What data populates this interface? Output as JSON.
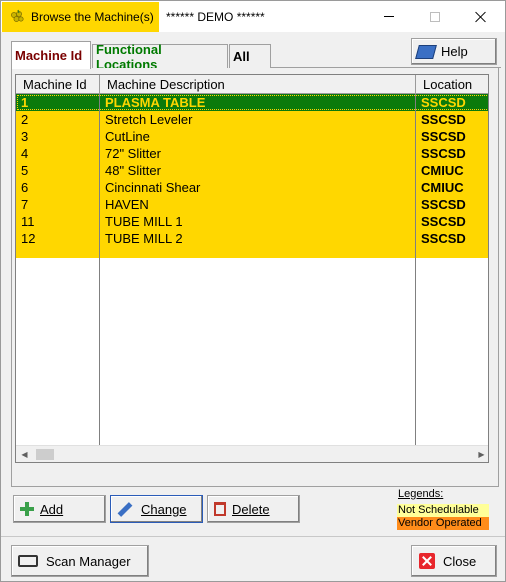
{
  "window": {
    "title": "Browse the Machine(s)",
    "subtitle": "****** DEMO ******",
    "accent_color": "#ffd700"
  },
  "tabs": [
    {
      "label": "Machine Id",
      "color": "#7a0000",
      "active": true
    },
    {
      "label": "Functional Locations",
      "color": "#007a00",
      "active": false
    },
    {
      "label": "All",
      "color": "#000000",
      "active": false
    }
  ],
  "help": {
    "label": "Help",
    "icon": "book-icon"
  },
  "grid": {
    "columns": [
      "Machine Id",
      "Machine Description",
      "Location"
    ],
    "rows": [
      {
        "id": "1",
        "description": "PLASMA TABLE",
        "location": "SSCSD",
        "selected": true
      },
      {
        "id": "2",
        "description": "Stretch Leveler",
        "location": "SSCSD"
      },
      {
        "id": "3",
        "description": "CutLine",
        "location": "SSCSD"
      },
      {
        "id": "4",
        "description": "72\" Slitter",
        "location": "SSCSD"
      },
      {
        "id": "5",
        "description": "48\" Slitter",
        "location": "CMIUC"
      },
      {
        "id": "6",
        "description": "Cincinnati Shear",
        "location": "CMIUC"
      },
      {
        "id": "7",
        "description": "HAVEN",
        "location": "SSCSD"
      },
      {
        "id": "11",
        "description": "TUBE MILL 1",
        "location": "SSCSD"
      },
      {
        "id": "12",
        "description": "TUBE MILL 2",
        "location": "SSCSD"
      }
    ],
    "row_color": "#ffd700",
    "selected_color": "#0b7a0b"
  },
  "buttons": {
    "add": "Add",
    "change": "Change",
    "delete": "Delete",
    "scan_manager": "Scan Manager",
    "close": "Close"
  },
  "legend": {
    "title": "Legends:",
    "items": [
      {
        "label": "Not Schedulable",
        "color": "#ffff99"
      },
      {
        "label": "Vendor Operated",
        "color": "#ff8c1a"
      }
    ]
  }
}
